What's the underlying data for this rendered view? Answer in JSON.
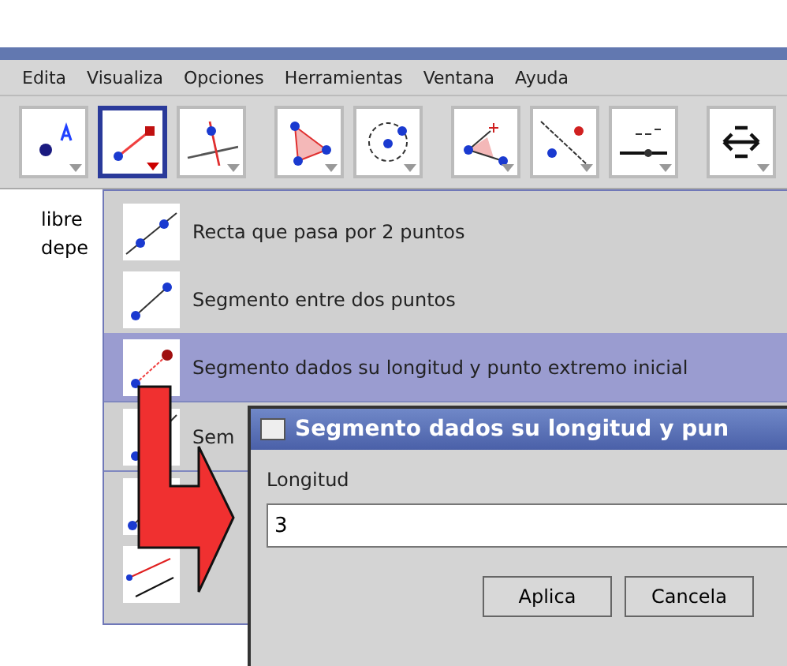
{
  "menu_bar": [
    "Edita",
    "Visualiza",
    "Opciones",
    "Herramientas",
    "Ventana",
    "Ayuda"
  ],
  "toolbar": [
    {
      "kind": "point",
      "selected": false,
      "group_start": false
    },
    {
      "kind": "segment",
      "selected": true,
      "group_start": false
    },
    {
      "kind": "perpendicular",
      "selected": false,
      "group_start": false
    },
    {
      "kind": "polygon",
      "selected": false,
      "group_start": true
    },
    {
      "kind": "circle",
      "selected": false,
      "group_start": false
    },
    {
      "kind": "angle",
      "selected": false,
      "group_start": true
    },
    {
      "kind": "reflect",
      "selected": false,
      "group_start": false
    },
    {
      "kind": "slider",
      "selected": false,
      "group_start": false
    },
    {
      "kind": "move",
      "selected": false,
      "group_start": true
    }
  ],
  "algebra_panel": [
    "libre",
    "depe"
  ],
  "dropdown": [
    {
      "kind": "line",
      "label": "Recta que pasa por 2 puntos",
      "selected": false
    },
    {
      "kind": "segment",
      "label": "Segmento entre dos puntos",
      "selected": false
    },
    {
      "kind": "segment-length",
      "label": "Segmento dados su longitud y punto extremo inicial",
      "selected": true
    },
    {
      "kind": "ray",
      "label": "Sem",
      "selected": false
    },
    {
      "kind": "vector",
      "selected": false
    },
    {
      "kind": "vector-from",
      "selected": false
    }
  ],
  "dialog": {
    "title": "Segmento dados su longitud y pun",
    "field_label": "Longitud",
    "value": "3",
    "buttons": [
      "Aplica",
      "Cancela"
    ]
  }
}
